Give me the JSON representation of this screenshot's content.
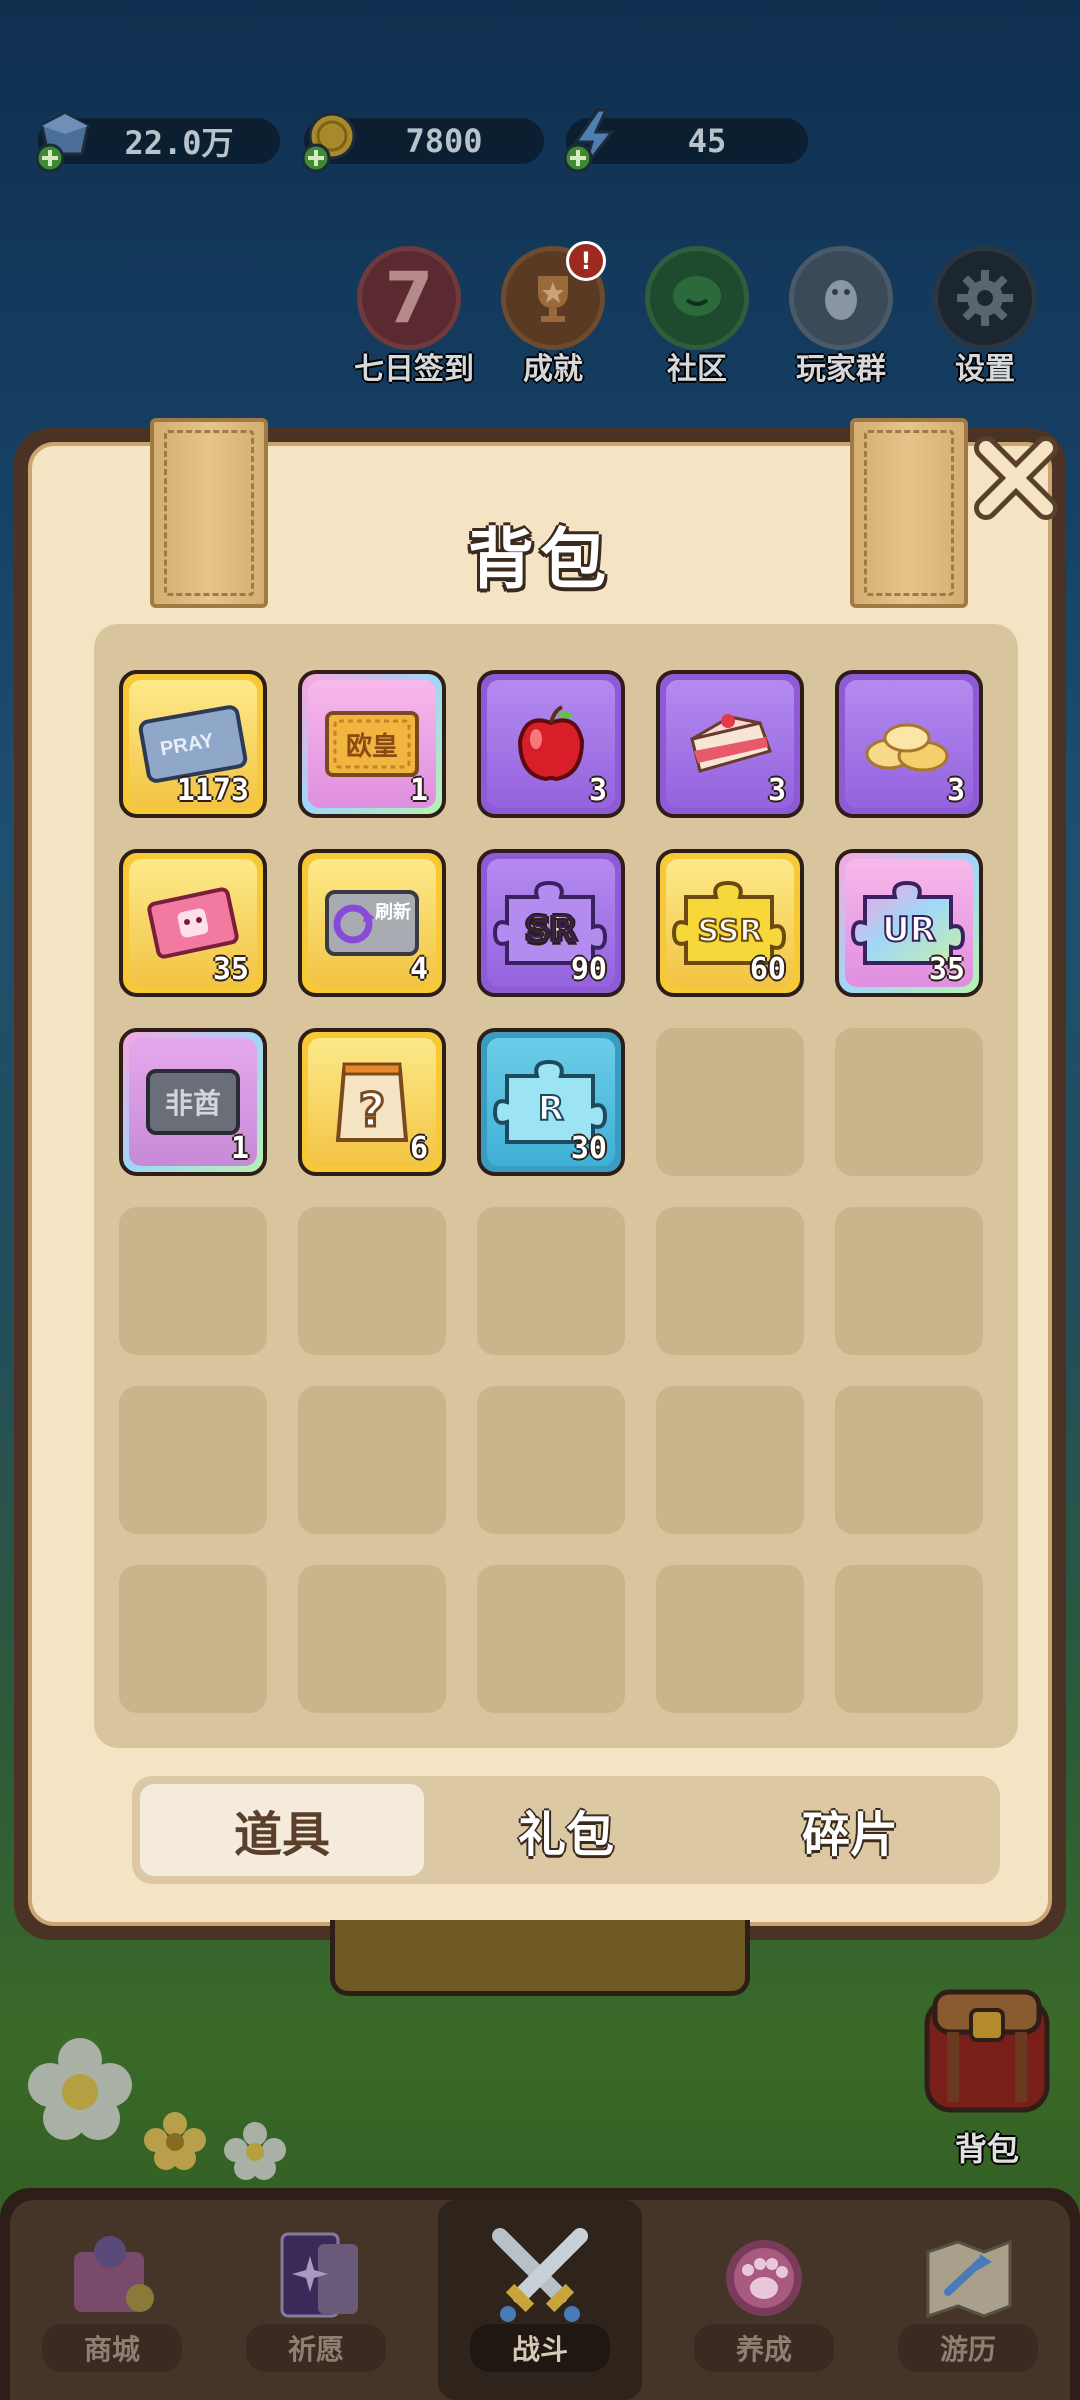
{
  "resources": {
    "gems": "22.0万",
    "coins": "7800",
    "energy": "45"
  },
  "shortcuts": [
    {
      "label": "七日签到",
      "icon": "seven-day-icon",
      "badge": ""
    },
    {
      "label": "成就",
      "icon": "trophy-icon",
      "badge": "!"
    },
    {
      "label": "社区",
      "icon": "chat-icon",
      "badge": ""
    },
    {
      "label": "玩家群",
      "icon": "penguin-icon",
      "badge": ""
    },
    {
      "label": "设置",
      "icon": "gear-icon",
      "badge": ""
    }
  ],
  "backpack": {
    "title": "背包",
    "items": [
      {
        "icon": "pray-ticket-icon",
        "frame": "gold",
        "text": "PRAY",
        "qty": "1173"
      },
      {
        "icon": "ouhuang-ticket-icon",
        "frame": "rainbow",
        "text": "欧皇",
        "qty": "1"
      },
      {
        "icon": "apple-icon",
        "frame": "purple",
        "text": "",
        "qty": "3"
      },
      {
        "icon": "cake-icon",
        "frame": "purple",
        "text": "",
        "qty": "3"
      },
      {
        "icon": "chips-icon",
        "frame": "purple",
        "text": "",
        "qty": "3"
      },
      {
        "icon": "pink-ticket-icon",
        "frame": "gold",
        "text": "",
        "qty": "35"
      },
      {
        "icon": "refresh-card-icon",
        "frame": "gold",
        "text": "刷新",
        "qty": "4"
      },
      {
        "icon": "sr-fragment-icon",
        "frame": "purple",
        "text": "SR",
        "qty": "90"
      },
      {
        "icon": "ssr-fragment-icon",
        "frame": "gold",
        "text": "SSR",
        "qty": "60"
      },
      {
        "icon": "ur-fragment-icon",
        "frame": "rainbow",
        "text": "UR",
        "qty": "35"
      },
      {
        "icon": "feiqiu-card-icon",
        "frame": "rainbow",
        "text": "非酋",
        "qty": "1"
      },
      {
        "icon": "mystery-bag-icon",
        "frame": "gold",
        "text": "?",
        "qty": "6"
      },
      {
        "icon": "r-fragment-icon",
        "frame": "blue",
        "text": "R",
        "qty": "30"
      }
    ],
    "tabs": [
      "道具",
      "礼包",
      "碎片"
    ]
  },
  "bag_button": {
    "label": "背包"
  },
  "nav": [
    {
      "label": "商城",
      "icon": "shop-icon"
    },
    {
      "label": "祈愿",
      "icon": "wish-card-icon"
    },
    {
      "label": "战斗",
      "icon": "crossed-swords-icon"
    },
    {
      "label": "养成",
      "icon": "paw-icon"
    },
    {
      "label": "游历",
      "icon": "map-icon"
    }
  ],
  "colors": {
    "panel": "#f4e4c3",
    "panel_border": "#4a3324",
    "slot": "#c9b48b",
    "gold_frame": "#f7c936",
    "purple_frame": "#8f5ad6",
    "blue_frame": "#3a9cc0"
  }
}
